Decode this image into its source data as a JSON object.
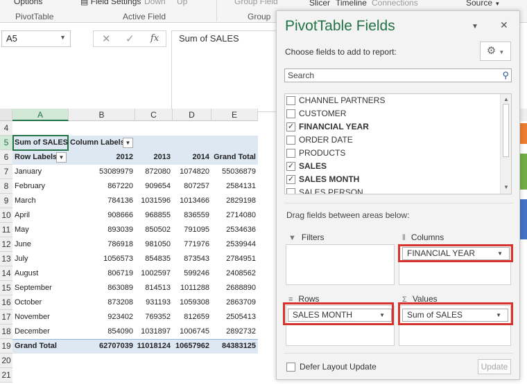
{
  "ribbon": {
    "options": "Options",
    "field_settings": "Field Settings",
    "drill_down": "Down",
    "drill_up": "Up",
    "group_field": "Group Field",
    "slicer": "Slicer",
    "timeline": "Timeline",
    "connections": "Connections",
    "source": "Source",
    "groups": {
      "pivottable": "PivotTable",
      "active_field": "Active Field",
      "group": "Group"
    }
  },
  "namebox": {
    "value": "A5"
  },
  "formula": {
    "value": "Sum of SALES"
  },
  "columns": [
    "A",
    "B",
    "C",
    "D",
    "E"
  ],
  "rows": [
    "4",
    "5",
    "6",
    "7",
    "8",
    "9",
    "10",
    "11",
    "12",
    "13",
    "14",
    "15",
    "16",
    "17",
    "18",
    "19",
    "20",
    "21"
  ],
  "pivot": {
    "corner_label": "Sum of SALES",
    "column_labels": "Column Labels",
    "row_labels": "Row Labels",
    "years": [
      "2012",
      "2013",
      "2014"
    ],
    "grand_total_label": "Grand Total",
    "months": [
      {
        "month": "January",
        "v": [
          "53089979",
          "872080",
          "1074820",
          "55036879"
        ]
      },
      {
        "month": "February",
        "v": [
          "867220",
          "909654",
          "807257",
          "2584131"
        ]
      },
      {
        "month": "March",
        "v": [
          "784136",
          "1031596",
          "1013466",
          "2829198"
        ]
      },
      {
        "month": "April",
        "v": [
          "908666",
          "968855",
          "836559",
          "2714080"
        ]
      },
      {
        "month": "May",
        "v": [
          "893039",
          "850502",
          "791095",
          "2534636"
        ]
      },
      {
        "month": "June",
        "v": [
          "786918",
          "981050",
          "771976",
          "2539944"
        ]
      },
      {
        "month": "July",
        "v": [
          "1056573",
          "854835",
          "873543",
          "2784951"
        ]
      },
      {
        "month": "August",
        "v": [
          "806719",
          "1002597",
          "599246",
          "2408562"
        ]
      },
      {
        "month": "September",
        "v": [
          "863089",
          "814513",
          "1011288",
          "2688890"
        ]
      },
      {
        "month": "October",
        "v": [
          "873208",
          "931193",
          "1059308",
          "2863709"
        ]
      },
      {
        "month": "November",
        "v": [
          "923402",
          "769352",
          "812659",
          "2505413"
        ]
      },
      {
        "month": "December",
        "v": [
          "854090",
          "1031897",
          "1006745",
          "2892732"
        ]
      }
    ],
    "grand_total": [
      "62707039",
      "11018124",
      "10657962",
      "84383125"
    ]
  },
  "pane": {
    "title": "PivotTable Fields",
    "subtitle": "Choose fields to add to report:",
    "search_placeholder": "Search",
    "fields": [
      {
        "name": "CHANNEL PARTNERS",
        "checked": false
      },
      {
        "name": "CUSTOMER",
        "checked": false
      },
      {
        "name": "FINANCIAL YEAR",
        "checked": true
      },
      {
        "name": "ORDER DATE",
        "checked": false
      },
      {
        "name": "PRODUCTS",
        "checked": false
      },
      {
        "name": "SALES",
        "checked": true
      },
      {
        "name": "SALES MONTH",
        "checked": true
      },
      {
        "name": "SALES PERSON",
        "checked": false
      }
    ],
    "drag_label": "Drag fields between areas below:",
    "areas": {
      "filters": "Filters",
      "columns": "Columns",
      "rows": "Rows",
      "values": "Values"
    },
    "chips": {
      "columns": "FINANCIAL YEAR",
      "rows": "SALES MONTH",
      "values": "Sum of SALES"
    },
    "defer_label": "Defer Layout Update",
    "update_label": "Update",
    "highlight_color": "#d9312b"
  }
}
